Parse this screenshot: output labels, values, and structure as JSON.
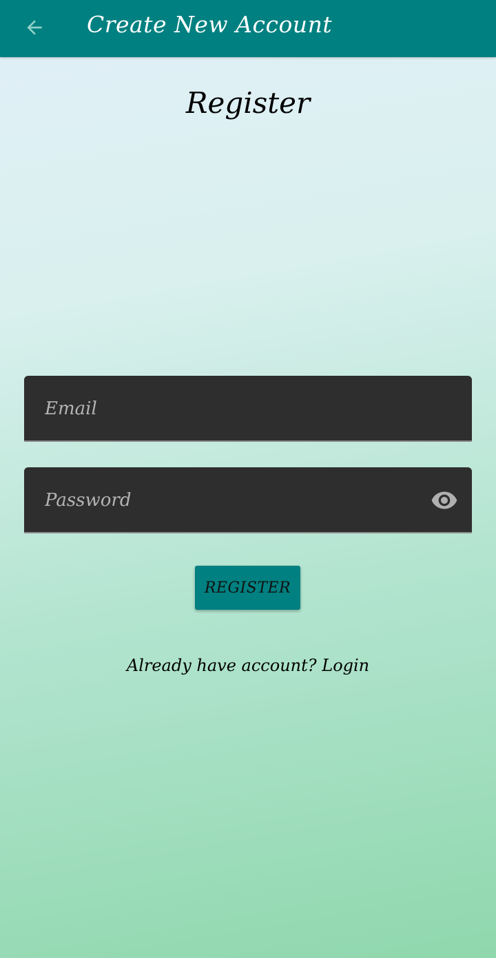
{
  "app_bar": {
    "title": "Create New Account",
    "back_icon": "arrow-left-icon",
    "background_color": "#008080"
  },
  "page": {
    "heading": "Register"
  },
  "form": {
    "email": {
      "placeholder": "Email",
      "value": ""
    },
    "password": {
      "placeholder": "Password",
      "value": "",
      "toggle_icon": "eye-icon"
    },
    "register_label": "REGISTER",
    "login_prompt": "Already have account? Login"
  },
  "colors": {
    "accent": "#008080",
    "field_background": "#2e2e2e"
  }
}
